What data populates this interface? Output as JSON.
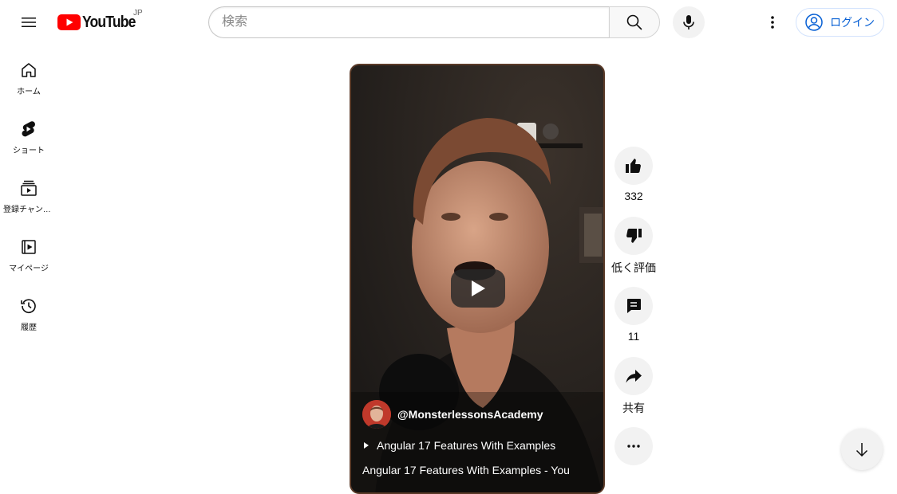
{
  "header": {
    "logo_text": "YouTube",
    "country_code": "JP",
    "search_placeholder": "検索",
    "login_label": "ログイン"
  },
  "sidebar": {
    "items": [
      {
        "label": "ホーム",
        "icon": "home-icon"
      },
      {
        "label": "ショート",
        "icon": "shorts-icon"
      },
      {
        "label": "登録チャンネル",
        "icon": "subscriptions-icon"
      },
      {
        "label": "マイページ",
        "icon": "my-page-icon"
      },
      {
        "label": "履歴",
        "icon": "history-icon"
      }
    ]
  },
  "short": {
    "channel_handle": "@MonsterlessonsAcademy",
    "playlist_title": "Angular 17 Features With Examples",
    "video_title": "Angular 17 Features With Examples - You"
  },
  "actions": {
    "like_count": "332",
    "dislike_label": "低く評価",
    "comment_count": "11",
    "share_label": "共有"
  },
  "colors": {
    "brand_red": "#ff0000",
    "link_blue": "#065fd4",
    "button_gray": "#f2f2f2"
  }
}
